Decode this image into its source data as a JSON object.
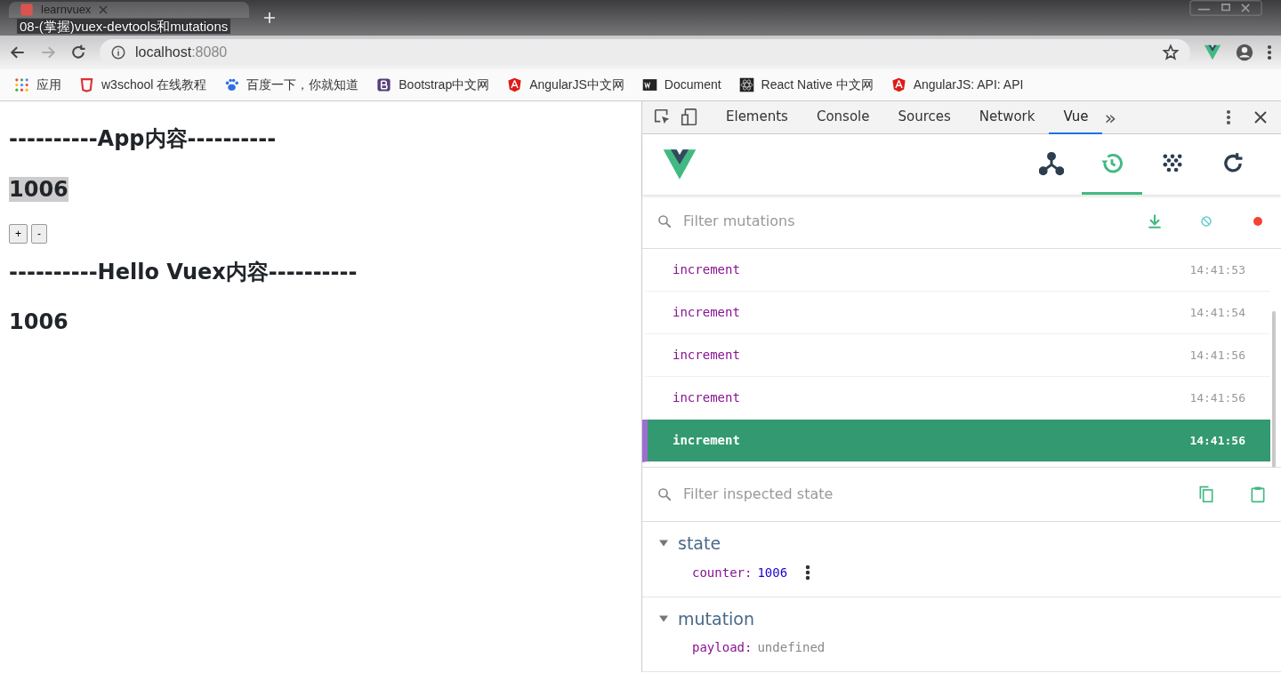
{
  "browser": {
    "tab_title": "learnvuex",
    "video_title": "08-(掌握)vuex-devtools和mutations",
    "address": "localhost",
    "port": ":8080",
    "bookmarks": [
      {
        "label": "应用",
        "kind": "apps"
      },
      {
        "label": "w3school 在线教程",
        "kind": "w3"
      },
      {
        "label": "百度一下，你就知道",
        "kind": "baidu"
      },
      {
        "label": "Bootstrap中文网",
        "kind": "bootstrap"
      },
      {
        "label": "AngularJS中文网",
        "kind": "angular"
      },
      {
        "label": "Document",
        "kind": "ws"
      },
      {
        "label": "React Native 中文网",
        "kind": "react"
      },
      {
        "label": "AngularJS: API: API",
        "kind": "angular"
      }
    ]
  },
  "page": {
    "app_heading": "----------App内容----------",
    "app_counter": "1006",
    "buttons": [
      "+",
      "-"
    ],
    "vuex_heading": "----------Hello Vuex内容----------",
    "vuex_counter": "1006"
  },
  "devtools": {
    "tabs": [
      {
        "label": "Elements",
        "selected": false
      },
      {
        "label": "Console",
        "selected": false
      },
      {
        "label": "Sources",
        "selected": false
      },
      {
        "label": "Network",
        "selected": false
      },
      {
        "label": "Vue",
        "selected": true
      }
    ],
    "more": "»",
    "vue_tabs": [
      {
        "kind": "components",
        "selected": false
      },
      {
        "kind": "history",
        "selected": true
      },
      {
        "kind": "events",
        "selected": false
      },
      {
        "kind": "refresh",
        "selected": false
      }
    ],
    "filter_mutations": {
      "placeholder": "Filter mutations"
    },
    "mutations": [
      {
        "name": "increment",
        "time": "14:41:53",
        "selected": false
      },
      {
        "name": "increment",
        "time": "14:41:54",
        "selected": false
      },
      {
        "name": "increment",
        "time": "14:41:56",
        "selected": false
      },
      {
        "name": "increment",
        "time": "14:41:56",
        "selected": false
      },
      {
        "name": "increment",
        "time": "14:41:56",
        "selected": true
      }
    ],
    "filter_state": {
      "placeholder": "Filter inspected state"
    },
    "sections": [
      {
        "title": "state",
        "expanded": true,
        "props": [
          {
            "key": "counter:",
            "value": "1006",
            "kind": "number"
          }
        ]
      },
      {
        "title": "mutation",
        "expanded": true,
        "props": [
          {
            "key": "payload:",
            "value": "undefined",
            "kind": "undefined"
          }
        ]
      }
    ]
  }
}
